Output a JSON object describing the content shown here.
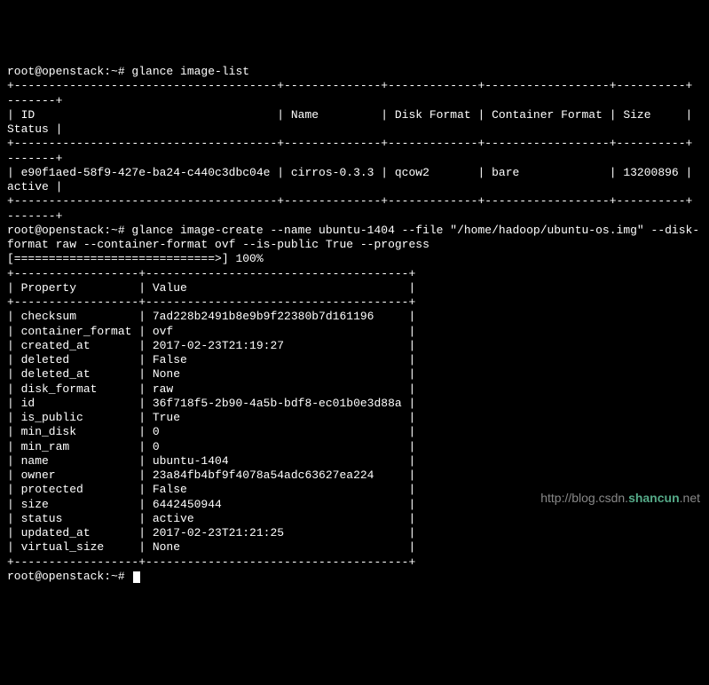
{
  "prompt1": "root@openstack:~# glance image-list",
  "list_header": "| ID                                   | Name         | Disk Format | Container Format | Size     |",
  "list_header2": "Status |",
  "list_row": "| e90f1aed-58f9-427e-ba24-c440c3dbc04e | cirros-0.3.3 | qcow2       | bare             | 13200896 |",
  "list_row2": "active |",
  "prompt2a": "root@openstack:~# glance image-create --name ubuntu-1404 --file \"/home/hadoop/ubuntu-os.img\" --disk-",
  "prompt2b": "format raw --container-format ovf --is-public True --progress",
  "progress": "[=============================>] 100%",
  "tbl_header": "| Property         | Value                                |",
  "tbl_border": "+------------------+--------------------------------------+",
  "rows": [
    [
      "checksum",
      "7ad228b2491b8e9b9f22380b7d161196"
    ],
    [
      "container_format",
      "ovf"
    ],
    [
      "created_at",
      "2017-02-23T21:19:27"
    ],
    [
      "deleted",
      "False"
    ],
    [
      "deleted_at",
      "None"
    ],
    [
      "disk_format",
      "raw"
    ],
    [
      "id",
      "36f718f5-2b90-4a5b-bdf8-ec01b0e3d88a"
    ],
    [
      "is_public",
      "True"
    ],
    [
      "min_disk",
      "0"
    ],
    [
      "min_ram",
      "0"
    ],
    [
      "name",
      "ubuntu-1404"
    ],
    [
      "owner",
      "23a84fb4bf9f4078a54adc63627ea224"
    ],
    [
      "protected",
      "False"
    ],
    [
      "size",
      "6442450944"
    ],
    [
      "status",
      "active"
    ],
    [
      "updated_at",
      "2017-02-23T21:21:25"
    ],
    [
      "virtual_size",
      "None"
    ]
  ],
  "prompt3": "root@openstack:~# ",
  "watermark_text": "http://blog.csdn.",
  "watermark_logo": "shancun",
  "list_border_top": "+--------------------------------------+--------------+-------------+------------------+----------+",
  "list_border_top2": "-------+",
  "list_border_bot": "+--------------------------------------+--------------+-------------+------------------+----------+",
  "list_border_bot2": "-------+"
}
